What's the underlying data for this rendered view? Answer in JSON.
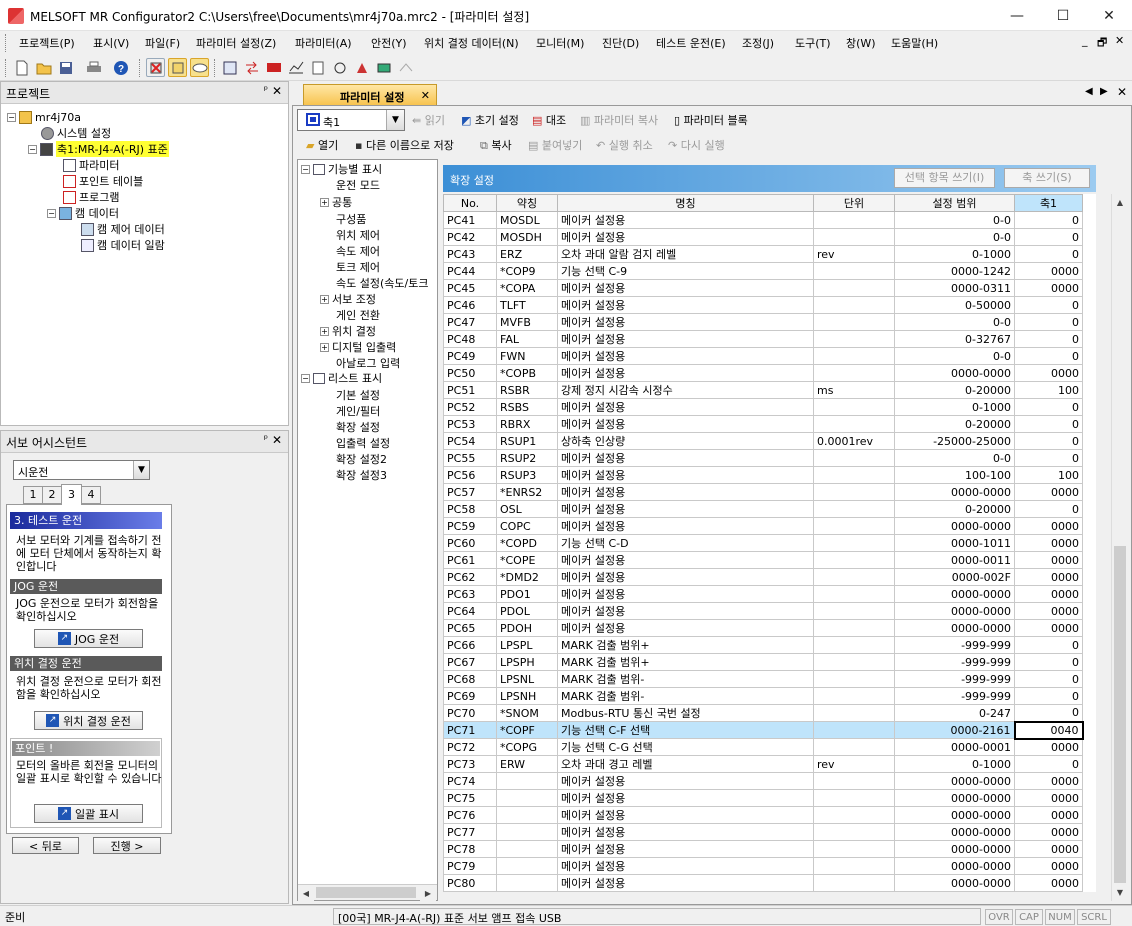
{
  "window": {
    "title": "MELSOFT MR Configurator2 C:\\Users\\free\\Documents\\mr4j70a.mrc2 - [파라미터 설정]",
    "minimize": "—",
    "maximize": "☐",
    "close": "✕"
  },
  "menu": [
    "프로젝트(P)",
    "표시(V)",
    "파일(F)",
    "파라미터 설정(Z)",
    "파라미터(A)",
    "안전(Y)",
    "위치 결정 데이터(N)",
    "모니터(M)",
    "진단(D)",
    "테스트 운전(E)",
    "조정(J)",
    "도구(T)",
    "창(W)",
    "도움말(H)"
  ],
  "mdi_controls": [
    "_",
    "🗗",
    "✕"
  ],
  "project_pane": {
    "title": "프로젝트",
    "pin": "ᵖ",
    "close": "✕",
    "tree": [
      "mr4j70a",
      "시스템 설정",
      "축1:MR-J4-A(-RJ) 표준",
      "파라미터",
      "포인트 테이블",
      "프로그램",
      "캠 데이터",
      "캠 제어 데이터",
      "캠 데이터 일람"
    ]
  },
  "servo_assistant": {
    "title": "서보 어시스턴트",
    "pin": "ᵖ",
    "close": "✕",
    "combo_value": "시운전",
    "tabs": [
      "1",
      "2",
      "3",
      "4"
    ],
    "step_title": "3.  테스트 운전",
    "step_text": "서보 모터와 기계를 접속하기 전에 모터 단체에서 동작하는지 확인합니다",
    "jog_header": "JOG 운전",
    "jog_text": "JOG 운전으로 모터가 회전함을 확인하십시오",
    "jog_button": "JOG 운전",
    "pos_header": "위치 결정 운전",
    "pos_text": "위치 결정 운전으로 모터가 회전함을 확인하십시오",
    "pos_button": "위치 결정 운전",
    "point_header": "포인트 !",
    "point_text": "모터의 올바른 회전을 모니터의 일괄 표시로 확인할 수 있습니다",
    "list_button": "일괄 표시",
    "back_button": "< 뒤로",
    "next_button": "진행 >"
  },
  "doc_tab": {
    "label": "파라미터 설정",
    "close": "✕"
  },
  "param_toolbar": {
    "axis_select": "축1",
    "read": "읽기",
    "initial": "초기 설정",
    "verify": "대조",
    "copy_param": "파라미터 복사",
    "param_block": "파라미터 블록",
    "open": "열기",
    "save_as": "다른 이름으로 저장",
    "copy": "복사",
    "paste": "붙여넣기",
    "undo": "실행 취소",
    "redo": "다시 실행"
  },
  "func_tree": [
    "기능별 표시",
    "운전 모드",
    "공통",
    "구성품",
    "위치 제어",
    "속도 제어",
    "토크 제어",
    "속도 설정(속도/토크",
    "서보 조정",
    "게인 전환",
    "위치 결정",
    "디지털 입출력",
    "아날로그 입력",
    "리스트 표시",
    "기본 설정",
    "게인/필터",
    "확장 설정",
    "입출력 설정",
    "확장 설정2",
    "확장 설정3"
  ],
  "grid_header": {
    "title": "확장 설정",
    "write_selected": "선택 항목 쓰기(I)",
    "write_axis": "축 쓰기(S)"
  },
  "columns": [
    "No.",
    "약칭",
    "명칭",
    "단위",
    "설정 범위",
    "축1"
  ],
  "rows": [
    [
      "PC41",
      "MOSDL",
      "메이커 설정용",
      "",
      "0-0",
      "0"
    ],
    [
      "PC42",
      "MOSDH",
      "메이커 설정용",
      "",
      "0-0",
      "0"
    ],
    [
      "PC43",
      "ERZ",
      "오차 과대 알람 검지 레벨",
      "rev",
      "0-1000",
      "0"
    ],
    [
      "PC44",
      "*COP9",
      "기능 선택 C-9",
      "",
      "0000-1242",
      "0000"
    ],
    [
      "PC45",
      "*COPA",
      "메이커 설정용",
      "",
      "0000-0311",
      "0000"
    ],
    [
      "PC46",
      "TLFT",
      "메이커 설정용",
      "",
      "0-50000",
      "0"
    ],
    [
      "PC47",
      "MVFB",
      "메이커 설정용",
      "",
      "0-0",
      "0"
    ],
    [
      "PC48",
      "FAL",
      "메이커 설정용",
      "",
      "0-32767",
      "0"
    ],
    [
      "PC49",
      "FWN",
      "메이커 설정용",
      "",
      "0-0",
      "0"
    ],
    [
      "PC50",
      "*COPB",
      "메이커 설정용",
      "",
      "0000-0000",
      "0000"
    ],
    [
      "PC51",
      "RSBR",
      "강제 정지 시감속 시정수",
      "ms",
      "0-20000",
      "100"
    ],
    [
      "PC52",
      "RSBS",
      "메이커 설정용",
      "",
      "0-1000",
      "0"
    ],
    [
      "PC53",
      "RBRX",
      "메이커 설정용",
      "",
      "0-20000",
      "0"
    ],
    [
      "PC54",
      "RSUP1",
      "상하축 인상량",
      "0.0001rev",
      "-25000-25000",
      "0"
    ],
    [
      "PC55",
      "RSUP2",
      "메이커 설정용",
      "",
      "0-0",
      "0"
    ],
    [
      "PC56",
      "RSUP3",
      "메이커 설정용",
      "",
      "100-100",
      "100"
    ],
    [
      "PC57",
      "*ENRS2",
      "메이커 설정용",
      "",
      "0000-0000",
      "0000"
    ],
    [
      "PC58",
      "OSL",
      "메이커 설정용",
      "",
      "0-20000",
      "0"
    ],
    [
      "PC59",
      "COPC",
      "메이커 설정용",
      "",
      "0000-0000",
      "0000"
    ],
    [
      "PC60",
      "*COPD",
      "기능 선택 C-D",
      "",
      "0000-1011",
      "0000"
    ],
    [
      "PC61",
      "*COPE",
      "메이커 설정용",
      "",
      "0000-0011",
      "0000"
    ],
    [
      "PC62",
      "*DMD2",
      "메이커 설정용",
      "",
      "0000-002F",
      "0000"
    ],
    [
      "PC63",
      "PDO1",
      "메이커 설정용",
      "",
      "0000-0000",
      "0000"
    ],
    [
      "PC64",
      "PDOL",
      "메이커 설정용",
      "",
      "0000-0000",
      "0000"
    ],
    [
      "PC65",
      "PDOH",
      "메이커 설정용",
      "",
      "0000-0000",
      "0000"
    ],
    [
      "PC66",
      "LPSPL",
      "MARK 검출 범위+",
      "",
      "-999-999",
      "0"
    ],
    [
      "PC67",
      "LPSPH",
      "MARK 검출 범위+",
      "",
      "-999-999",
      "0"
    ],
    [
      "PC68",
      "LPSNL",
      "MARK 검출 범위-",
      "",
      "-999-999",
      "0"
    ],
    [
      "PC69",
      "LPSNH",
      "MARK 검출 범위-",
      "",
      "-999-999",
      "0"
    ],
    [
      "PC70",
      "*SNOM",
      "Modbus-RTU 통신 국번 설정",
      "",
      "0-247",
      "0"
    ],
    [
      "PC71",
      "*COPF",
      "기능 선택 C-F 선택",
      "",
      "0000-2161",
      "0040"
    ],
    [
      "PC72",
      "*COPG",
      "기능 선택 C-G 선택",
      "",
      "0000-0001",
      "0000"
    ],
    [
      "PC73",
      "ERW",
      "오차 과대 경고 레벨",
      "rev",
      "0-1000",
      "0"
    ],
    [
      "PC74",
      "",
      "메이커 설정용",
      "",
      "0000-0000",
      "0000"
    ],
    [
      "PC75",
      "",
      "메이커 설정용",
      "",
      "0000-0000",
      "0000"
    ],
    [
      "PC76",
      "",
      "메이커 설정용",
      "",
      "0000-0000",
      "0000"
    ],
    [
      "PC77",
      "",
      "메이커 설정용",
      "",
      "0000-0000",
      "0000"
    ],
    [
      "PC78",
      "",
      "메이커 설정용",
      "",
      "0000-0000",
      "0000"
    ],
    [
      "PC79",
      "",
      "메이커 설정용",
      "",
      "0000-0000",
      "0000"
    ],
    [
      "PC80",
      "",
      "메이커 설정용",
      "",
      "0000-0000",
      "0000"
    ]
  ],
  "selected_row": "PC71",
  "status": {
    "left": "준비",
    "center": "[00국] MR-J4-A(-RJ) 표준 서보 앰프 접속 USB",
    "indicators": [
      "OVR",
      "CAP",
      "NUM",
      "SCRL"
    ]
  }
}
